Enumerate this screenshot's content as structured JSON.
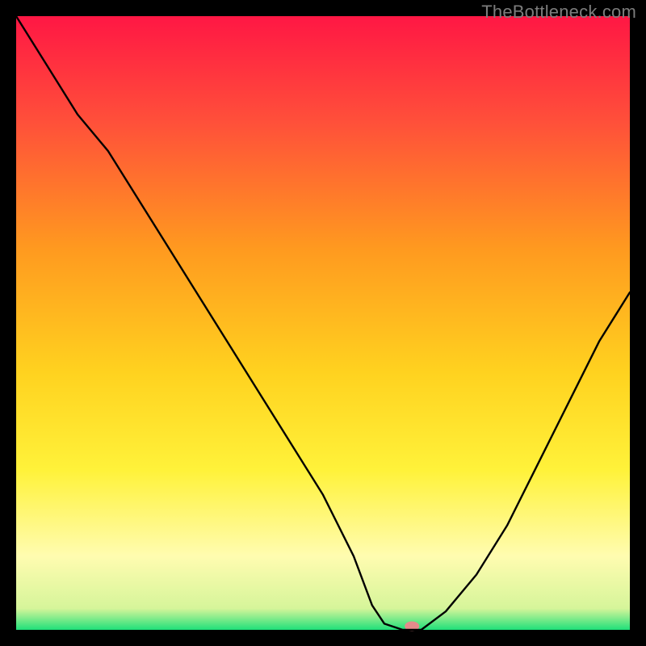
{
  "watermark": {
    "text": "TheBottleneck.com"
  },
  "chart_data": {
    "type": "line",
    "title": "",
    "xlabel": "",
    "ylabel": "",
    "xlim": [
      0,
      100
    ],
    "ylim": [
      0,
      100
    ],
    "grid": false,
    "legend": false,
    "background": "vertical-gradient red→orange→yellow→pale-yellow→green",
    "gradient_stops": [
      {
        "offset": 0.0,
        "color": "#ff1744"
      },
      {
        "offset": 0.17,
        "color": "#ff4f3a"
      },
      {
        "offset": 0.38,
        "color": "#ff9a1f"
      },
      {
        "offset": 0.58,
        "color": "#ffd21f"
      },
      {
        "offset": 0.74,
        "color": "#fff23a"
      },
      {
        "offset": 0.88,
        "color": "#fffcb0"
      },
      {
        "offset": 0.965,
        "color": "#d6f59a"
      },
      {
        "offset": 1.0,
        "color": "#1fe07a"
      }
    ],
    "series": [
      {
        "name": "bottleneck-curve",
        "color": "#000000",
        "x": [
          0,
          5,
          10,
          15,
          20,
          25,
          30,
          35,
          40,
          45,
          50,
          55,
          58,
          60,
          63,
          66,
          70,
          75,
          80,
          85,
          90,
          95,
          100
        ],
        "y": [
          100,
          92,
          84,
          78,
          70,
          62,
          54,
          46,
          38,
          30,
          22,
          12,
          4,
          1,
          0,
          0,
          3,
          9,
          17,
          27,
          37,
          47,
          55
        ]
      }
    ],
    "marker": {
      "name": "optimal-point",
      "x": 64.5,
      "y": 0.6,
      "color": "#e58b8b",
      "rx": 9,
      "ry": 6
    }
  }
}
